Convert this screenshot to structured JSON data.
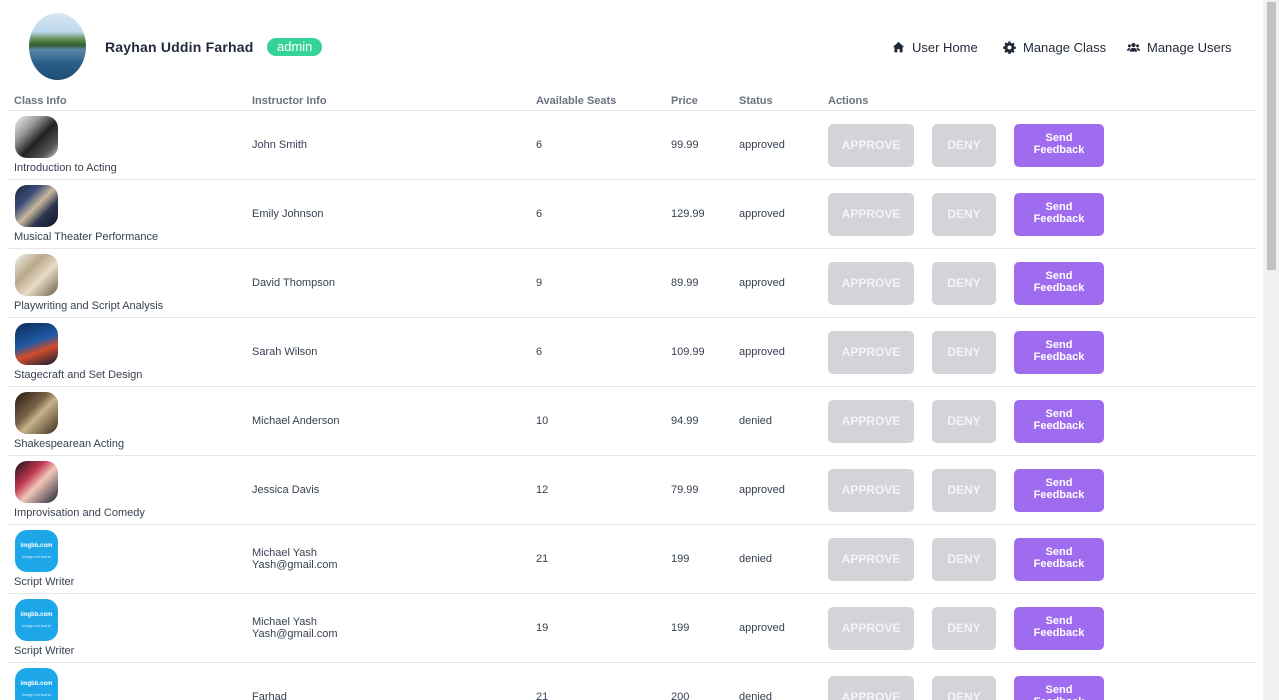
{
  "header": {
    "user_name": "Rayhan Uddin Farhad",
    "role": "admin",
    "nav": [
      {
        "label": "User Home",
        "icon": "home-icon"
      },
      {
        "label": "Manage Class",
        "icon": "gear-icon"
      },
      {
        "label": "Manage Users",
        "icon": "users-icon"
      }
    ]
  },
  "table": {
    "columns": [
      "Class Info",
      "Instructor Info",
      "Available Seats",
      "Price",
      "Status",
      "Actions"
    ],
    "actions": {
      "approve": "APPROVE",
      "deny": "DENY",
      "feedback": "Send Feedback"
    },
    "thumb_text": {
      "brand": "imgbb.com",
      "sub": "image not found"
    },
    "rows": [
      {
        "class_name": "Introduction to Acting",
        "instructor": "John Smith",
        "email": "",
        "seats": "6",
        "price": "99.99",
        "status": "approved"
      },
      {
        "class_name": "Musical Theater Performance",
        "instructor": "Emily Johnson",
        "email": "",
        "seats": "6",
        "price": "129.99",
        "status": "approved"
      },
      {
        "class_name": "Playwriting and Script Analysis",
        "instructor": "David Thompson",
        "email": "",
        "seats": "9",
        "price": "89.99",
        "status": "approved"
      },
      {
        "class_name": "Stagecraft and Set Design",
        "instructor": "Sarah Wilson",
        "email": "",
        "seats": "6",
        "price": "109.99",
        "status": "approved"
      },
      {
        "class_name": "Shakespearean Acting",
        "instructor": "Michael Anderson",
        "email": "",
        "seats": "10",
        "price": "94.99",
        "status": "denied"
      },
      {
        "class_name": "Improvisation and Comedy",
        "instructor": "Jessica Davis",
        "email": "",
        "seats": "12",
        "price": "79.99",
        "status": "approved"
      },
      {
        "class_name": "Script Writer",
        "instructor": "Michael Yash",
        "email": "Yash@gmail.com",
        "seats": "21",
        "price": "199",
        "status": "denied"
      },
      {
        "class_name": "Script Writer",
        "instructor": "Michael Yash",
        "email": "Yash@gmail.com",
        "seats": "19",
        "price": "199",
        "status": "approved"
      },
      {
        "class_name": "",
        "instructor": "Farhad",
        "email": "",
        "seats": "21",
        "price": "200",
        "status": "denied"
      }
    ]
  }
}
